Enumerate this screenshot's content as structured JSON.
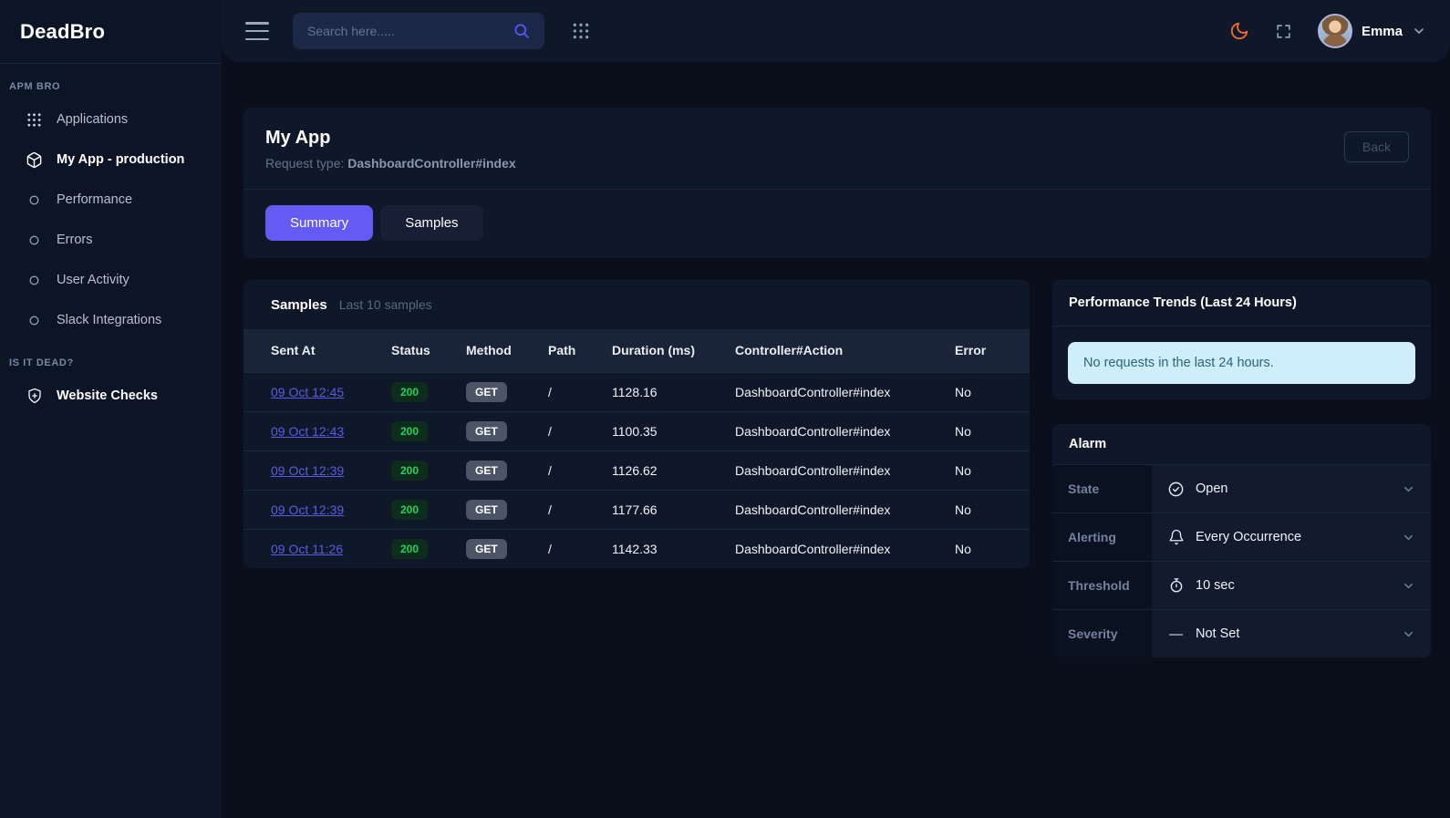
{
  "brand": {
    "name": "DeadBro"
  },
  "sidebar": {
    "sections": [
      {
        "label": "APM BRO",
        "items": [
          {
            "label": "Applications",
            "icon": "apps-grid-icon"
          },
          {
            "label": "My App - production",
            "icon": "cube-icon",
            "active": true
          },
          {
            "label": "Performance",
            "icon": "circle-icon"
          },
          {
            "label": "Errors",
            "icon": "circle-icon"
          },
          {
            "label": "User Activity",
            "icon": "circle-icon"
          },
          {
            "label": "Slack Integrations",
            "icon": "circle-icon"
          }
        ]
      },
      {
        "label": "IS IT DEAD?",
        "items": [
          {
            "label": "Website Checks",
            "icon": "shield-plus-icon"
          }
        ]
      }
    ]
  },
  "topbar": {
    "search_placeholder": "Search here.....",
    "user": {
      "name": "Emma"
    }
  },
  "page_header": {
    "title": "My App",
    "subtitle_label": "Request type:",
    "subtitle_value": "DashboardController#index",
    "back_label": "Back",
    "tabs": [
      {
        "label": "Summary",
        "active": true
      },
      {
        "label": "Samples",
        "active": false
      }
    ]
  },
  "samples": {
    "title": "Samples",
    "subtitle": "Last 10 samples",
    "columns": [
      "Sent At",
      "Status",
      "Method",
      "Path",
      "Duration (ms)",
      "Controller#Action",
      "Error"
    ],
    "rows": [
      {
        "sent_at": "09 Oct 12:45",
        "status": "200",
        "method": "GET",
        "path": "/",
        "duration": "1128.16",
        "controller_action": "DashboardController#index",
        "error": "No"
      },
      {
        "sent_at": "09 Oct 12:43",
        "status": "200",
        "method": "GET",
        "path": "/",
        "duration": "1100.35",
        "controller_action": "DashboardController#index",
        "error": "No"
      },
      {
        "sent_at": "09 Oct 12:39",
        "status": "200",
        "method": "GET",
        "path": "/",
        "duration": "1126.62",
        "controller_action": "DashboardController#index",
        "error": "No"
      },
      {
        "sent_at": "09 Oct 12:39",
        "status": "200",
        "method": "GET",
        "path": "/",
        "duration": "1177.66",
        "controller_action": "DashboardController#index",
        "error": "No"
      },
      {
        "sent_at": "09 Oct 11:26",
        "status": "200",
        "method": "GET",
        "path": "/",
        "duration": "1142.33",
        "controller_action": "DashboardController#index",
        "error": "No"
      }
    ]
  },
  "performance_trends": {
    "title": "Performance Trends (Last 24 Hours)",
    "message": "No requests in the last 24 hours."
  },
  "alarm": {
    "title": "Alarm",
    "rows": [
      {
        "label": "State",
        "value": "Open",
        "icon": "check-circle-icon"
      },
      {
        "label": "Alerting",
        "value": "Every Occurrence",
        "icon": "bell-icon"
      },
      {
        "label": "Threshold",
        "value": "10 sec",
        "icon": "stopwatch-icon"
      },
      {
        "label": "Severity",
        "value": "Not Set",
        "icon": "dash-icon"
      }
    ]
  },
  "colors": {
    "accent_purple": "#655af5",
    "link_purple": "#5a5ce0",
    "success_green": "#21d35e",
    "moon_orange": "#ee6d2d",
    "info_alert_bg": "#cfeefb",
    "info_alert_text": "#2c6479",
    "page_bg": "#0a0f1b",
    "card_bg": "#0f1829",
    "sidebar_bg": "#0c1526"
  }
}
